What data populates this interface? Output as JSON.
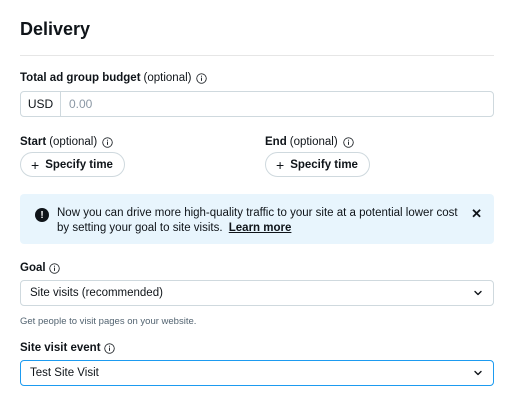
{
  "section": {
    "title": "Delivery"
  },
  "budget": {
    "label": "Total ad group budget",
    "optional": "(optional)",
    "currency": "USD",
    "placeholder": "0.00"
  },
  "start": {
    "label": "Start",
    "optional": "(optional)",
    "button": "Specify time"
  },
  "end": {
    "label": "End",
    "optional": "(optional)",
    "button": "Specify time"
  },
  "banner": {
    "icon": "!",
    "text": "Now you can drive more high-quality traffic to your site at a potential lower cost by setting your goal to site visits.",
    "link": "Learn more",
    "close": "✕"
  },
  "goal": {
    "label": "Goal",
    "value": "Site visits (recommended)",
    "helper": "Get people to visit pages on your website."
  },
  "site_visit_event": {
    "label": "Site visit event",
    "value": "Test Site Visit"
  },
  "colors": {
    "accent": "#1d9bf0",
    "banner_bg": "#e8f5fd",
    "border": "#cfd9de"
  }
}
